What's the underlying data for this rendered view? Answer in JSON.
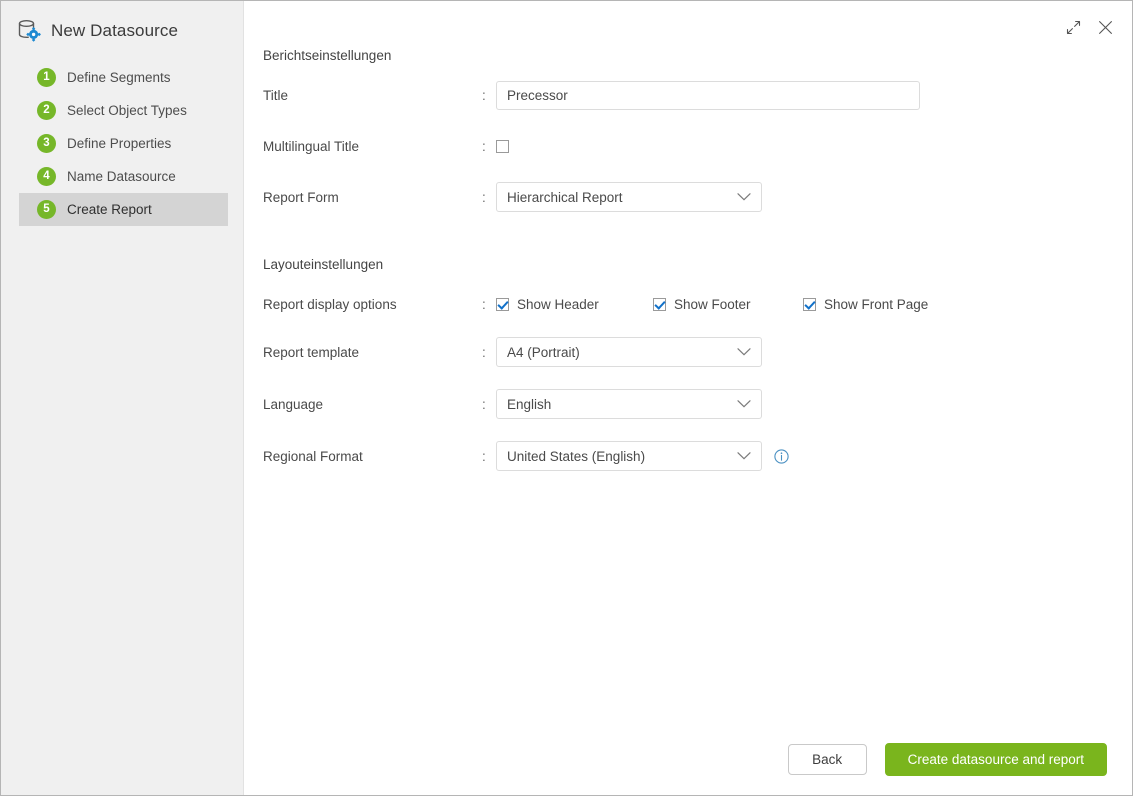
{
  "window": {
    "title": "New Datasource",
    "app_icon": "database-gear-icon",
    "controls": [
      {
        "name": "expand-icon",
        "label": "Expand"
      },
      {
        "name": "close-icon",
        "label": "Close"
      }
    ]
  },
  "sidebar": {
    "steps": [
      {
        "number": "1",
        "label": "Define Segments",
        "active": false
      },
      {
        "number": "2",
        "label": "Select Object Types",
        "active": false
      },
      {
        "number": "3",
        "label": "Define Properties",
        "active": false
      },
      {
        "number": "4",
        "label": "Name Datasource",
        "active": false
      },
      {
        "number": "5",
        "label": "Create Report",
        "active": true
      }
    ]
  },
  "report_settings": {
    "section_title": "Berichtseinstellungen",
    "title": {
      "label": "Title",
      "colon": ":",
      "value": "Precessor",
      "placeholder": ""
    },
    "multilingual_title": {
      "label": "Multilingual Title",
      "colon": ":",
      "checked": false
    },
    "report_form": {
      "label": "Report Form",
      "colon": ":",
      "value": "Hierarchical Report",
      "options": [
        "Hierarchical Report"
      ]
    }
  },
  "layout_settings": {
    "section_title": "Layouteinstellungen",
    "display_options": {
      "label": "Report display options",
      "colon": ":",
      "items": [
        {
          "label": "Show Header",
          "checked": true
        },
        {
          "label": "Show Footer",
          "checked": true
        },
        {
          "label": "Show Front Page",
          "checked": true
        }
      ]
    },
    "report_template": {
      "label": "Report template",
      "colon": ":",
      "value": "A4 (Portrait)",
      "options": [
        "A4 (Portrait)"
      ]
    },
    "language": {
      "label": "Language",
      "colon": ":",
      "value": "English",
      "options": [
        "English"
      ]
    },
    "regional_format": {
      "label": "Regional Format",
      "colon": ":",
      "value": "United States (English)",
      "options": [
        "United States (English)"
      ],
      "info_icon": "info-icon"
    }
  },
  "footer": {
    "back_label": "Back",
    "primary_label": "Create datasource and report"
  },
  "colors": {
    "accent_green": "#7ab51d",
    "badge_green": "#76b729",
    "checkbox_blue": "#1271c9",
    "sidebar_bg": "#f0f0f0",
    "active_step_bg": "#d4d4d4",
    "info_blue": "#4a90c2"
  }
}
